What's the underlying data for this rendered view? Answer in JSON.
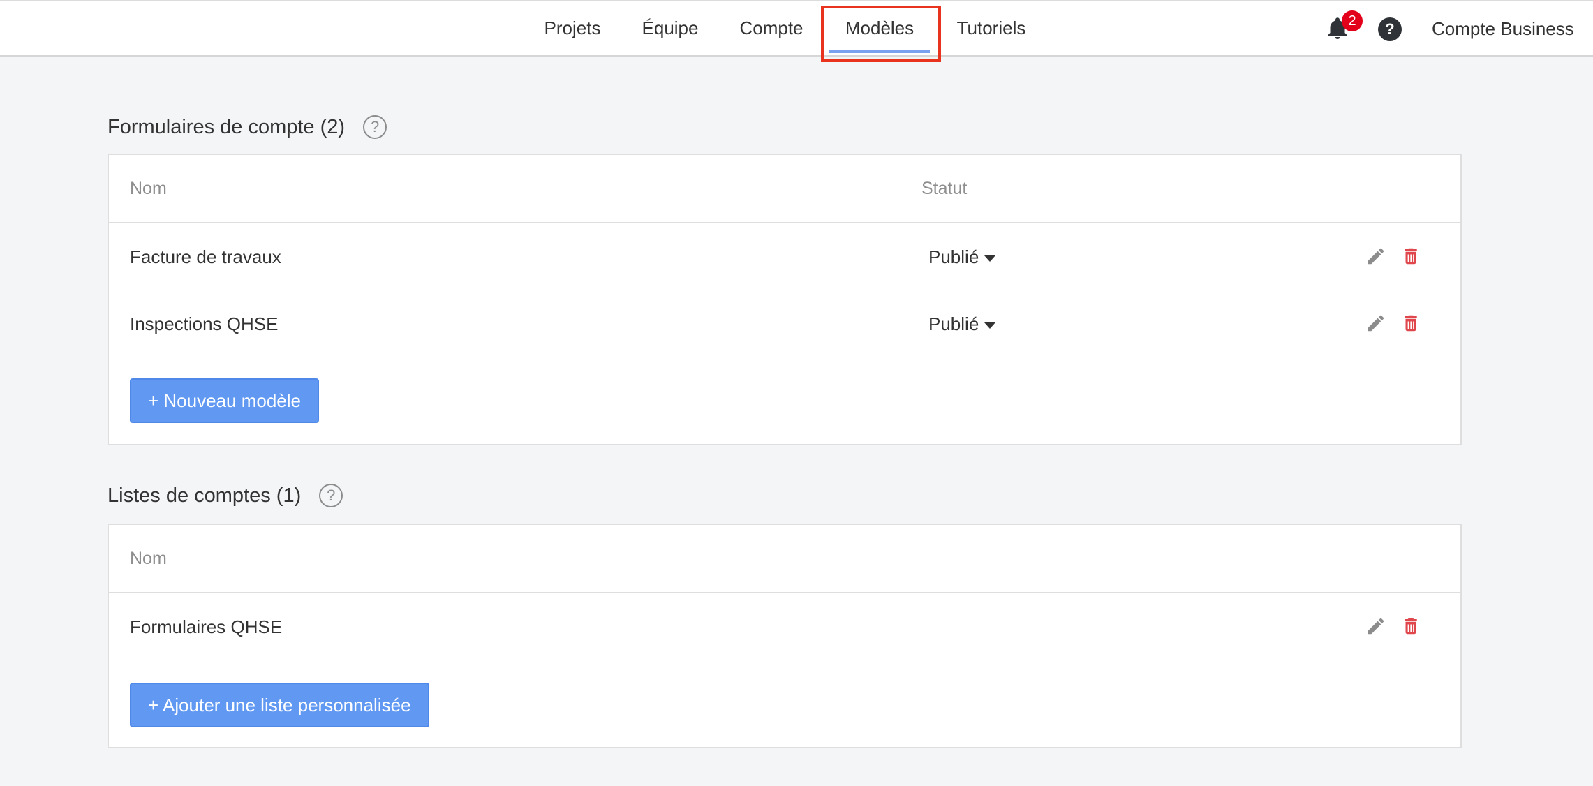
{
  "nav": {
    "tabs": [
      {
        "label": "Projets"
      },
      {
        "label": "Équipe"
      },
      {
        "label": "Compte"
      },
      {
        "label": "Modèles",
        "active": true
      },
      {
        "label": "Tutoriels"
      }
    ],
    "notifications_count": "2",
    "help_label": "?",
    "account_label": "Compte Business"
  },
  "forms_section": {
    "title": "Formulaires de compte (2)",
    "help": "?",
    "col_name": "Nom",
    "col_status": "Statut",
    "rows": [
      {
        "name": "Facture de travaux",
        "status": "Publié"
      },
      {
        "name": "Inspections QHSE",
        "status": "Publié"
      }
    ],
    "new_button": "+ Nouveau modèle"
  },
  "lists_section": {
    "title": "Listes de comptes (1)",
    "help": "?",
    "col_name": "Nom",
    "rows": [
      {
        "name": "Formulaires QHSE"
      }
    ],
    "add_button": "+ Ajouter une liste personnalisée"
  },
  "colors": {
    "accent": "#6199f2",
    "active_underline": "#7aa0f0",
    "delete": "#e0474c",
    "badge": "#e3001b",
    "highlight": "#e8331f"
  },
  "icons": {
    "notification": "bell-icon",
    "help": "question-circle-icon",
    "edit": "pencil-icon",
    "delete": "trash-icon",
    "status_dropdown": "caret-down-icon"
  }
}
